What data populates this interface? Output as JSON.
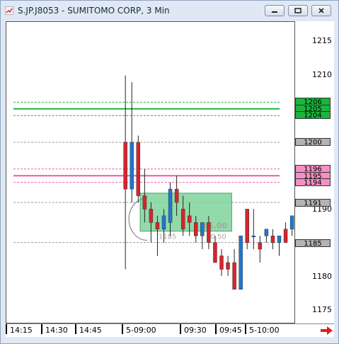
{
  "window": {
    "title": "S.JP.J8053 - SUMITOMO CORP, 3 Min"
  },
  "colors": {
    "up": "#1e78d2",
    "down": "#d8242c",
    "green_line": "#1ab53c",
    "pink_line": "#ea5aa8",
    "gray_line": "#999999",
    "position_fill": "#7fd39a"
  },
  "price_axis": {
    "ticks": [
      "1215",
      "1210",
      "1190",
      "1180",
      "1175"
    ],
    "boxes": [
      {
        "label": "1206",
        "bg": "#1ab53c"
      },
      {
        "label": "1205",
        "bg": "#1ab53c"
      },
      {
        "label": "1204",
        "bg": "#1ab53c"
      },
      {
        "label": "1200",
        "bg": "#b3b3b3"
      },
      {
        "label": "1196",
        "bg": "#f58fc6"
      },
      {
        "label": "1195",
        "bg": "#f58fc6"
      },
      {
        "label": "1194",
        "bg": "#f58fc6"
      },
      {
        "label": "1191",
        "bg": "#b3b3b3"
      },
      {
        "label": "1185",
        "bg": "#b3b3b3"
      }
    ]
  },
  "position": {
    "entry_label": "1185",
    "pl_label": "$6.00",
    "qty_label": "0.50"
  },
  "time_axis": {
    "labels": [
      "14:15",
      "14:30",
      "14:45",
      "5-09:00",
      "09:30",
      "09:45",
      "5-10:00"
    ]
  },
  "chart_data": {
    "type": "candlestick",
    "title": "S.JP.J8053 - SUMITOMO CORP, 3 Min",
    "ylim": [
      1173,
      1218
    ],
    "yticks": [
      1175,
      1180,
      1190,
      1210,
      1215
    ],
    "candles": [
      {
        "open": 1200,
        "high": 1210,
        "low": 1181,
        "close": 1193
      },
      {
        "open": 1193,
        "high": 1209,
        "low": 1191,
        "close": 1200
      },
      {
        "open": 1200,
        "high": 1201,
        "low": 1191,
        "close": 1192
      },
      {
        "open": 1192,
        "high": 1196,
        "low": 1188,
        "close": 1190
      },
      {
        "open": 1190,
        "high": 1191,
        "low": 1185,
        "close": 1188
      },
      {
        "open": 1188,
        "high": 1189,
        "low": 1183,
        "close": 1187
      },
      {
        "open": 1187,
        "high": 1190,
        "low": 1185,
        "close": 1189
      },
      {
        "open": 1188,
        "high": 1194,
        "low": 1186,
        "close": 1193
      },
      {
        "open": 1193,
        "high": 1195,
        "low": 1189,
        "close": 1191
      },
      {
        "open": 1190,
        "high": 1192,
        "low": 1186,
        "close": 1187
      },
      {
        "open": 1189,
        "high": 1191,
        "low": 1186,
        "close": 1188
      },
      {
        "open": 1188,
        "high": 1189,
        "low": 1185,
        "close": 1186
      },
      {
        "open": 1186,
        "high": 1188,
        "low": 1184,
        "close": 1188
      },
      {
        "open": 1188,
        "high": 1189,
        "low": 1184,
        "close": 1185
      },
      {
        "open": 1185,
        "high": 1186,
        "low": 1183,
        "close": 1182
      },
      {
        "open": 1183,
        "high": 1184,
        "low": 1180,
        "close": 1181
      },
      {
        "open": 1182,
        "high": 1183,
        "low": 1180,
        "close": 1181
      },
      {
        "open": 1182,
        "high": 1184,
        "low": 1178,
        "close": 1178
      },
      {
        "open": 1178,
        "high": 1186,
        "low": 1178,
        "close": 1186
      },
      {
        "open": 1190,
        "high": 1190,
        "low": 1184,
        "close": 1185
      },
      {
        "open": 1186,
        "high": 1190,
        "low": 1184,
        "close": 1186
      },
      {
        "open": 1185,
        "high": 1186,
        "low": 1182,
        "close": 1184
      },
      {
        "open": 1186,
        "high": 1187,
        "low": 1185,
        "close": 1187
      },
      {
        "open": 1186,
        "high": 1187,
        "low": 1184,
        "close": 1185
      },
      {
        "open": 1185,
        "high": 1186,
        "low": 1183,
        "close": 1186
      },
      {
        "open": 1187,
        "high": 1188,
        "low": 1185,
        "close": 1185
      },
      {
        "open": 1187,
        "high": 1189,
        "low": 1186,
        "close": 1189
      }
    ],
    "levels": [
      {
        "price": 1206,
        "color": "#1ab53c",
        "style": "dashed"
      },
      {
        "price": 1205,
        "color": "#1ab53c",
        "style": "solid"
      },
      {
        "price": 1204,
        "color": "#1ab53c",
        "style": "dashed"
      },
      {
        "price": 1200,
        "color": "#999999",
        "style": "dashed"
      },
      {
        "price": 1196,
        "color": "#ea5aa8",
        "style": "dashed"
      },
      {
        "price": 1195,
        "color": "#ea5aa8",
        "style": "solid"
      },
      {
        "price": 1194,
        "color": "#ea5aa8",
        "style": "dashed"
      },
      {
        "price": 1191,
        "color": "#999999",
        "style": "dashed"
      },
      {
        "price": 1185,
        "color": "#999999",
        "style": "dashed"
      }
    ]
  }
}
